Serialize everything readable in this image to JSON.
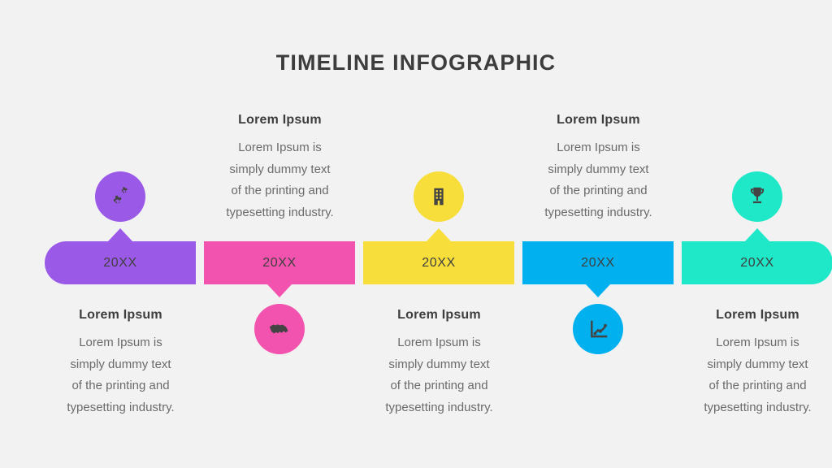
{
  "page": {
    "title": "TIMELINE INFOGRAPHIC",
    "background_color": "#f2f2f2",
    "title_color": "#3d3d3d"
  },
  "timeline": {
    "segments": [
      {
        "year": "20XX",
        "color": "#9b59e8",
        "icon": "gears-icon",
        "icon_position": "above",
        "arrow_direction": "up",
        "text_position": "below",
        "heading": "Lorem Ipsum",
        "body_lines": [
          "Lorem Ipsum is",
          "simply dummy text",
          "of the printing and",
          "typesetting industry."
        ]
      },
      {
        "year": "20XX",
        "color": "#f253ae",
        "icon": "handshake-icon",
        "icon_position": "below",
        "arrow_direction": "down",
        "text_position": "above",
        "heading": "Lorem Ipsum",
        "body_lines": [
          "Lorem Ipsum is",
          "simply dummy text",
          "of the printing and",
          "typesetting industry."
        ]
      },
      {
        "year": "20XX",
        "color": "#f7de3a",
        "icon": "building-icon",
        "icon_position": "above",
        "arrow_direction": "up",
        "text_position": "below",
        "heading": "Lorem Ipsum",
        "body_lines": [
          "Lorem Ipsum is",
          "simply dummy text",
          "of the printing and",
          "typesetting industry."
        ]
      },
      {
        "year": "20XX",
        "color": "#00b0ef",
        "icon": "line-chart-icon",
        "icon_position": "below",
        "arrow_direction": "down",
        "text_position": "above",
        "heading": "Lorem Ipsum",
        "body_lines": [
          "Lorem Ipsum is",
          "simply dummy text",
          "of the printing and",
          "typesetting industry."
        ]
      },
      {
        "year": "20XX",
        "color": "#1fe8c8",
        "icon": "trophy-icon",
        "icon_position": "above",
        "arrow_direction": "up",
        "text_position": "below",
        "heading": "Lorem Ipsum",
        "body_lines": [
          "Lorem Ipsum is",
          "simply dummy text",
          "of the printing and",
          "typesetting industry."
        ]
      }
    ]
  }
}
